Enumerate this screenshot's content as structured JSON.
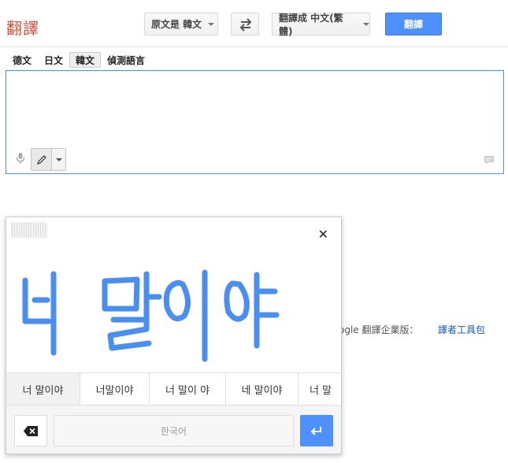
{
  "header": {
    "logo": "翻譯",
    "source_lang_select": "原文是 韓文",
    "target_lang_select": "翻譯成 中文(繁體)",
    "translate_button": "翻譯"
  },
  "source_tabs": [
    {
      "label": "德文",
      "active": false
    },
    {
      "label": "日文",
      "active": false
    },
    {
      "label": "韓文",
      "active": true
    },
    {
      "label": "偵測語言",
      "active": false
    }
  ],
  "source": {
    "text": "",
    "input_tools_icon": "pencil-icon"
  },
  "footer": {
    "enterprise_text": "ogle 翻譯企業版：",
    "toolkit_link": "譯者工具包"
  },
  "handwriting": {
    "candidates": [
      "너 말이야",
      "너말이야",
      "너 말이 야",
      "네 말이야",
      "너 말"
    ],
    "space_label": "한국어",
    "stroke_color": "#4a8ef0"
  },
  "colors": {
    "accent": "#4d90fe",
    "logo": "#dd4b39",
    "link": "#1155cc"
  }
}
